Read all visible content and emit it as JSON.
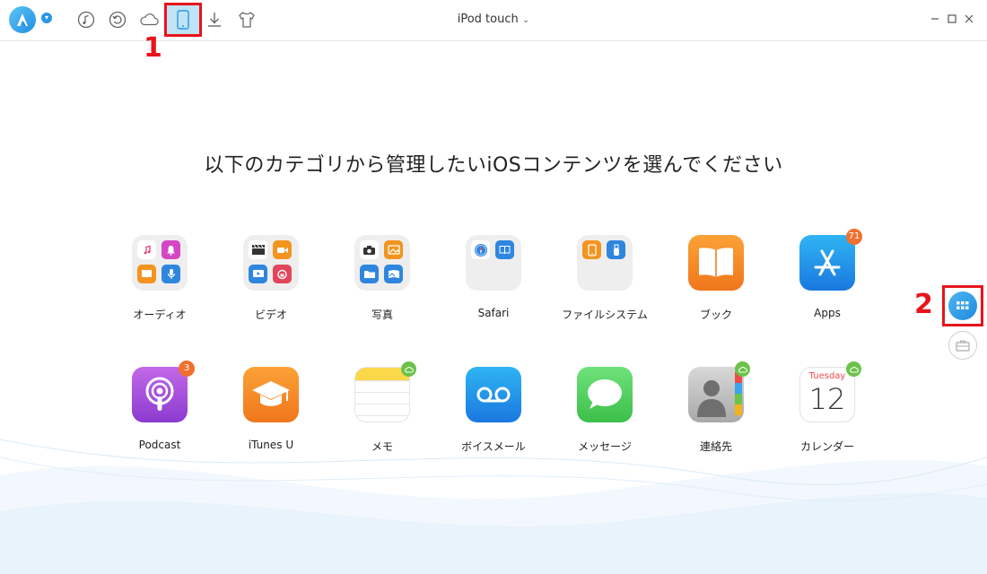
{
  "topbar": {
    "device_title": "iPod  touch",
    "tools": [
      {
        "name": "music-icon"
      },
      {
        "name": "restore-icon"
      },
      {
        "name": "icloud-icon"
      },
      {
        "name": "device-icon",
        "active": true
      },
      {
        "name": "download-icon"
      },
      {
        "name": "tshirt-icon"
      }
    ],
    "window_controls": [
      "minimize",
      "maximize",
      "close"
    ]
  },
  "annotations": {
    "first": "1",
    "second": "2",
    "color": "#e8141b"
  },
  "main": {
    "headline": "以下のカテゴリから管理したいiOSコンテンツを選んでください",
    "categories": [
      {
        "label": "オーディオ"
      },
      {
        "label": "ビデオ"
      },
      {
        "label": "写真"
      },
      {
        "label": "Safari"
      },
      {
        "label": "ファイルシステム"
      },
      {
        "label": "ブック"
      },
      {
        "label": "Apps",
        "badge": "71"
      },
      {
        "label": "Podcast",
        "badge": "3"
      },
      {
        "label": "iTunes U"
      },
      {
        "label": "メモ"
      },
      {
        "label": "ボイスメール"
      },
      {
        "label": "メッセージ"
      },
      {
        "label": "連絡先"
      },
      {
        "label": "カレンダー",
        "calendar_day": "Tuesday",
        "calendar_date": "12"
      }
    ]
  },
  "side": {
    "buttons": [
      {
        "name": "category-grid-button",
        "active": true
      },
      {
        "name": "toolkit-button",
        "active": false
      }
    ]
  },
  "colors": {
    "accent": "#2a97e6",
    "badge": "#f1702f",
    "cloud": "#6cc24a"
  }
}
